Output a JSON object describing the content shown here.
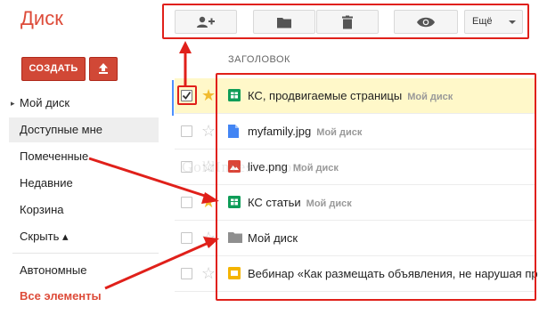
{
  "app": {
    "title": "Диск"
  },
  "sidebar": {
    "create_label": "СОЗДАТЬ",
    "upload_icon": "upload-icon",
    "items": [
      {
        "label": "Мой диск"
      },
      {
        "label": "Доступные мне",
        "active": true
      },
      {
        "label": "Помеченные"
      },
      {
        "label": "Недавние"
      },
      {
        "label": "Корзина"
      },
      {
        "label": "Скрыть ▴"
      },
      {
        "label": "Автономные"
      },
      {
        "label": "Все элементы"
      }
    ]
  },
  "toolbar": {
    "buttons": [
      "share-icon",
      "move-to-folder-icon",
      "delete-icon",
      "preview-eye-icon"
    ],
    "more_label": "Ещё"
  },
  "list": {
    "header": "ЗАГОЛОВОК",
    "rows": [
      {
        "name": "КС, продвигаемые страницы",
        "location": "Мой диск",
        "type": "spreadsheet",
        "starred": true,
        "checked": true
      },
      {
        "name": "myfamily.jpg",
        "location": "Мой диск",
        "type": "document",
        "starred": false,
        "checked": false
      },
      {
        "name": "live.png",
        "location": "Мой диск",
        "type": "image",
        "starred": false,
        "checked": false
      },
      {
        "name": "КС статьи",
        "location": "Мой диск",
        "type": "spreadsheet",
        "starred": true,
        "checked": false
      },
      {
        "name": "Мой диск",
        "location": "",
        "type": "folder",
        "starred": false,
        "checked": false
      },
      {
        "name": "Вебинар «Как размещать объявления, не нарушая пр",
        "location": "",
        "type": "presentation",
        "starred": false,
        "checked": false
      }
    ]
  },
  "colors": {
    "accent_red": "#dd4b39",
    "annotation_red": "#e0201a",
    "star_yellow": "#f1bb2f",
    "sheet_green": "#0f9d58",
    "doc_blue": "#4285f4",
    "slides_yellow": "#f4b400"
  }
}
